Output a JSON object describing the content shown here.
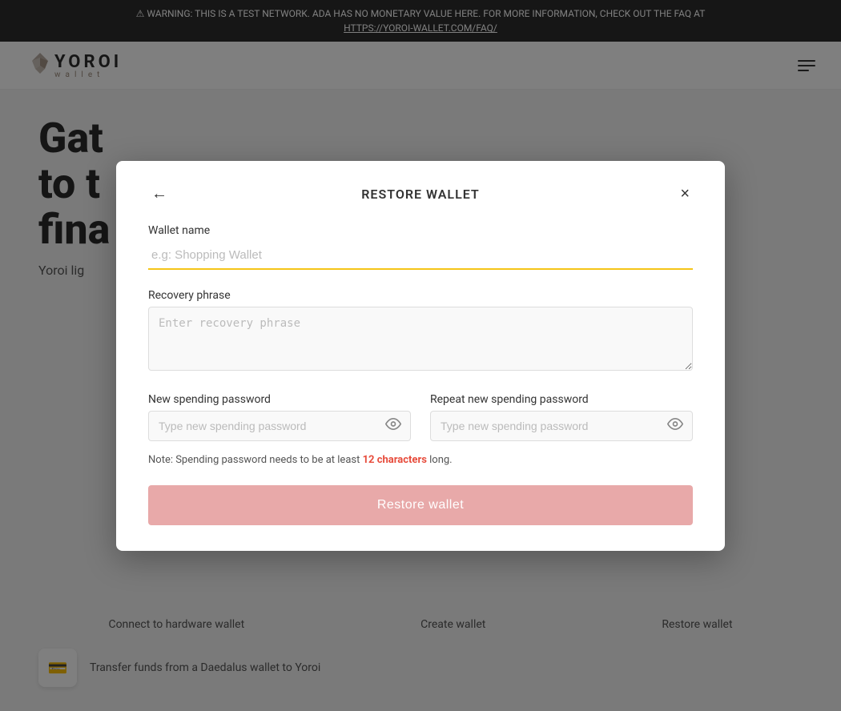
{
  "warning": {
    "text": "⚠ WARNING: THIS IS A TEST NETWORK. ADA HAS NO MONETARY VALUE HERE. FOR MORE INFORMATION, CHECK OUT THE FAQ AT",
    "link_text": "HTTPS://YOROI-WALLET.COM/FAQ/",
    "link_href": "https://yoroi-wallet.com/faq/"
  },
  "header": {
    "logo_title": "YOROI",
    "logo_subtitle": "wallet",
    "menu_label": "Menu"
  },
  "background": {
    "title_line1": "Gat",
    "title_line2": "to t",
    "title_line3": "fina",
    "subtitle": "Yoroi lig"
  },
  "modal": {
    "title": "RESTORE WALLET",
    "back_label": "←",
    "close_label": "×",
    "wallet_name_label": "Wallet name",
    "wallet_name_placeholder": "e.g: Shopping Wallet",
    "recovery_phrase_label": "Recovery phrase",
    "recovery_phrase_placeholder": "Enter recovery phrase",
    "new_password_label": "New spending password",
    "new_password_placeholder": "Type new spending password",
    "repeat_password_label": "Repeat new spending password",
    "repeat_password_placeholder": "Type new spending password",
    "note_text": "Note: Spending password needs to be at least ",
    "note_highlight": "12 characters",
    "note_suffix": " long.",
    "restore_button_label": "Restore wallet"
  },
  "bottom_actions": {
    "connect_label": "Connect to hardware wallet",
    "create_label": "Create wallet",
    "restore_label": "Restore wallet"
  },
  "transfer": {
    "text": "Transfer funds from a Daedalus wallet to Yoroi"
  },
  "colors": {
    "accent_yellow": "#f5c518",
    "button_disabled": "#e8a9a9",
    "warning_bg": "#2d2d2d"
  }
}
